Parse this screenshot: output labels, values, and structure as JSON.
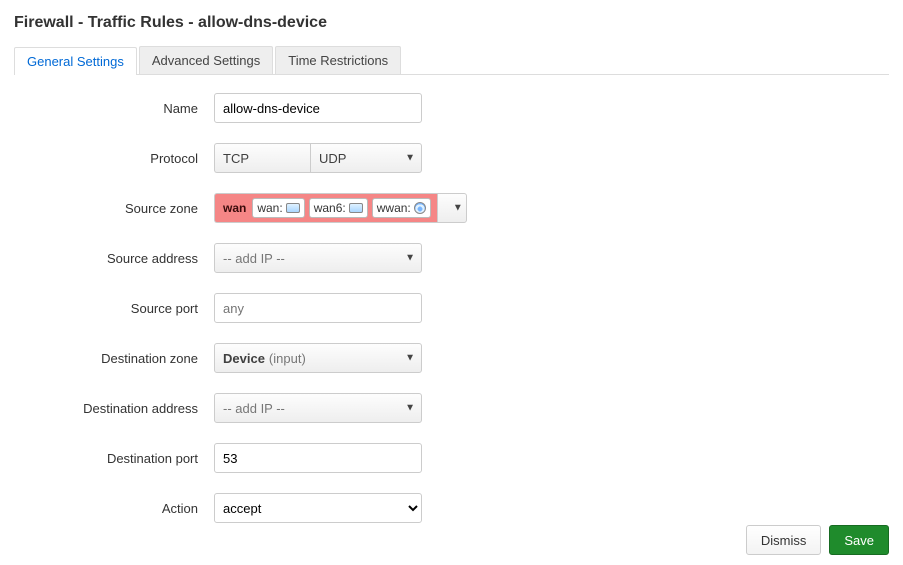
{
  "title": "Firewall - Traffic Rules - allow-dns-device",
  "tabs": [
    {
      "label": "General Settings",
      "active": true
    },
    {
      "label": "Advanced Settings",
      "active": false
    },
    {
      "label": "Time Restrictions",
      "active": false
    }
  ],
  "fields": {
    "name": {
      "label": "Name",
      "value": "allow-dns-device"
    },
    "protocol": {
      "label": "Protocol",
      "left": "TCP",
      "right": "UDP"
    },
    "src_zone": {
      "label": "Source zone",
      "zone_name": "wan",
      "interfaces": [
        {
          "name": "wan:",
          "icon": "eth"
        },
        {
          "name": "wan6:",
          "icon": "eth"
        },
        {
          "name": "wwan:",
          "icon": "wifi"
        }
      ]
    },
    "src_addr": {
      "label": "Source address",
      "placeholder": "-- add IP --"
    },
    "src_port": {
      "label": "Source port",
      "placeholder": "any",
      "value": ""
    },
    "dest_zone": {
      "label": "Destination zone",
      "selected_bold": "Device",
      "selected_muted": "(input)"
    },
    "dest_addr": {
      "label": "Destination address",
      "placeholder": "-- add IP --"
    },
    "dest_port": {
      "label": "Destination port",
      "value": "53"
    },
    "action": {
      "label": "Action",
      "value": "accept"
    }
  },
  "buttons": {
    "dismiss": "Dismiss",
    "save": "Save"
  }
}
